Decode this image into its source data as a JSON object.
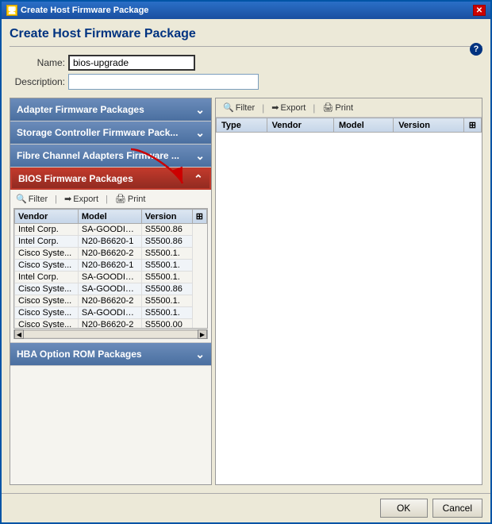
{
  "titlebar": {
    "title": "Create Host Firmware Package",
    "close_label": "✕"
  },
  "dialog": {
    "title": "Create Host Firmware Package",
    "help_label": "?",
    "name_label": "Name:",
    "name_value": "bios-upgrade",
    "desc_label": "Description:",
    "desc_value": ""
  },
  "left_panel": {
    "sections": [
      {
        "id": "adapter",
        "label": "Adapter Firmware Packages",
        "active": false,
        "expanded": false
      },
      {
        "id": "storage",
        "label": "Storage Controller Firmware Pack...",
        "active": false,
        "expanded": false
      },
      {
        "id": "fibre",
        "label": "Fibre Channel Adapters Firmware ...",
        "active": false,
        "expanded": false
      },
      {
        "id": "bios",
        "label": "BIOS Firmware Packages",
        "active": true,
        "expanded": true
      }
    ],
    "bios_toolbar": {
      "filter_label": "Filter",
      "export_label": "Export",
      "print_label": "Print"
    },
    "bios_table": {
      "columns": [
        "Vendor",
        "Model",
        "Version"
      ],
      "rows": [
        [
          "Intel Corp.",
          "SA-GOODING",
          "S5500.86"
        ],
        [
          "Intel Corp.",
          "N20-B6620-1",
          "S5500.86"
        ],
        [
          "Cisco Syste...",
          "N20-B6620-2",
          "S5500.1."
        ],
        [
          "Cisco Syste...",
          "N20-B6620-1",
          "S5500.1."
        ],
        [
          "Intel Corp.",
          "SA-GOODING",
          "S5500.1."
        ],
        [
          "Cisco Syste...",
          "SA-GOODING",
          "S5500.86"
        ],
        [
          "Cisco Syste...",
          "N20-B6620-2",
          "S5500.1."
        ],
        [
          "Cisco Syste...",
          "SA-GOODING",
          "S5500.1."
        ],
        [
          "Cisco Syste...",
          "N20-B6620-2",
          "S5500.00"
        ]
      ]
    },
    "hba_section": {
      "label": "HBA Option ROM Packages"
    }
  },
  "right_panel": {
    "toolbar": {
      "filter_label": "Filter",
      "export_label": "Export",
      "print_label": "Print"
    },
    "table": {
      "columns": [
        "Type",
        "Vendor",
        "Model",
        "Version"
      ]
    }
  },
  "footer": {
    "ok_label": "OK",
    "cancel_label": "Cancel"
  }
}
